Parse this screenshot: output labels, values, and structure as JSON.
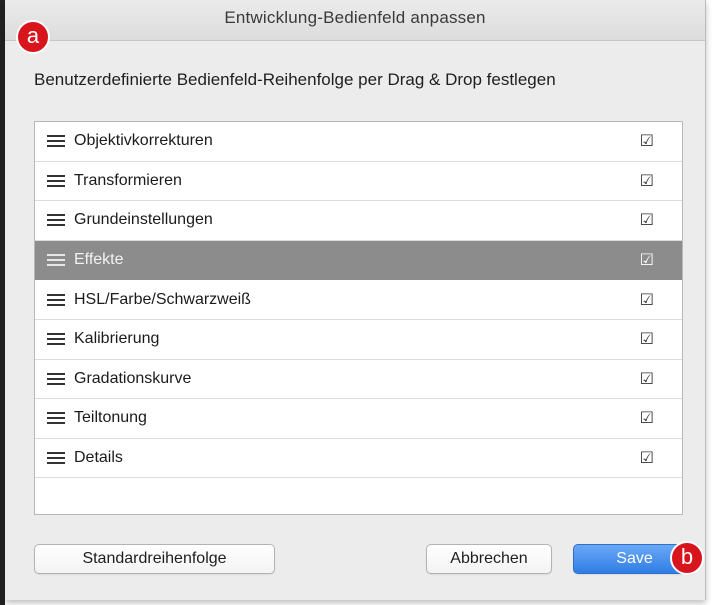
{
  "window": {
    "title": "Entwicklung-Bedienfeld anpassen"
  },
  "instructions": "Benutzerdefinierte Bedienfeld-Reihenfolge per Drag & Drop festlegen",
  "panels": [
    {
      "label": "Objektivkorrekturen",
      "checked": true,
      "selected": false
    },
    {
      "label": "Transformieren",
      "checked": true,
      "selected": false
    },
    {
      "label": "Grundeinstellungen",
      "checked": true,
      "selected": false
    },
    {
      "label": "Effekte",
      "checked": true,
      "selected": true
    },
    {
      "label": "HSL/Farbe/Schwarzweiß",
      "checked": true,
      "selected": false
    },
    {
      "label": "Kalibrierung",
      "checked": true,
      "selected": false
    },
    {
      "label": "Gradationskurve",
      "checked": true,
      "selected": false
    },
    {
      "label": "Teiltonung",
      "checked": true,
      "selected": false
    },
    {
      "label": "Details",
      "checked": true,
      "selected": false
    }
  ],
  "buttons": {
    "default_order": "Standardreihenfolge",
    "cancel": "Abbrechen",
    "save": "Save"
  },
  "callouts": {
    "a": "a",
    "b": "b"
  },
  "icons": {
    "drag_handle": "drag-handle-icon",
    "checkbox": "checkbox-checked-icon"
  },
  "colors": {
    "selected_row": "#8c8c8c",
    "save_button": "#2f7ee6",
    "callout_badge": "#d8151c"
  }
}
